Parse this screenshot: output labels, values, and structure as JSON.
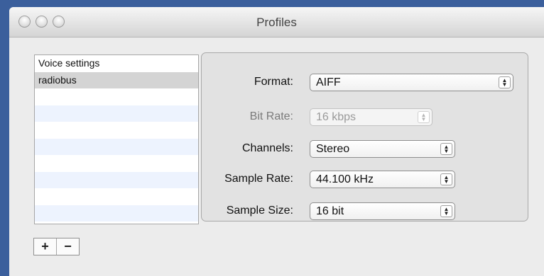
{
  "window": {
    "title": "Profiles"
  },
  "profiles": {
    "items": [
      "Voice settings",
      "radiobus"
    ],
    "selected": "radiobus"
  },
  "list_controls": {
    "add": "+",
    "remove": "−"
  },
  "settings": {
    "format": {
      "label": "Format:",
      "value": "AIFF"
    },
    "bit_rate": {
      "label": "Bit Rate:",
      "value": "16 kbps"
    },
    "channels": {
      "label": "Channels:",
      "value": "Stereo"
    },
    "sample_rate": {
      "label": "Sample Rate:",
      "value": "44.100 kHz"
    },
    "sample_size": {
      "label": "Sample Size:",
      "value": "16 bit"
    }
  },
  "icons": {
    "popup_arrows": "up-down-arrows-icon",
    "close": "close-icon",
    "minimize": "minimize-icon",
    "zoom": "zoom-icon"
  }
}
